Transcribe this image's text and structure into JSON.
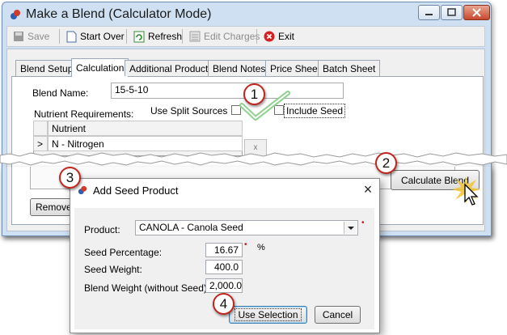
{
  "window": {
    "title": "Make a Blend (Calculator Mode)"
  },
  "toolbar": {
    "save": "Save",
    "start_over": "Start Over",
    "refresh": "Refresh",
    "edit_charges": "Edit Charges",
    "exit": "Exit"
  },
  "tabs": [
    {
      "label": "Blend Setup",
      "active": false
    },
    {
      "label": "Calculation",
      "active": true
    },
    {
      "label": "Additional Products",
      "active": false
    },
    {
      "label": "Blend Notes",
      "active": false
    },
    {
      "label": "Price Sheet",
      "active": false
    },
    {
      "label": "Batch Sheet",
      "active": false
    }
  ],
  "calc": {
    "blend_name_label": "Blend Name:",
    "blend_name_value": "15-5-10",
    "nutrient_req_label": "Nutrient Requirements:",
    "split_sources_label": "Use Split Sources",
    "include_seed_label": "Include Seed",
    "grid": {
      "header": "Nutrient",
      "rows": [
        {
          "marker": ">",
          "value": "N - Nitrogen"
        }
      ],
      "clear": "x"
    },
    "calculate_label": "Calculate Blend",
    "remove_label": "Remove"
  },
  "dialog": {
    "title": "Add Seed Product",
    "close_label": "×",
    "product_label": "Product:",
    "product_value": "CANOLA - Canola Seed",
    "seed_pct_label": "Seed Percentage:",
    "seed_pct_value": "16.67",
    "pct_unit": "%",
    "seed_weight_label": "Seed Weight:",
    "seed_weight_value": "400.0",
    "blend_weight_label": "Blend Weight (without Seed):",
    "blend_weight_value": "2,000.0",
    "use_selection": "Use Selection",
    "cancel": "Cancel"
  },
  "callouts": [
    "1",
    "2",
    "3",
    "4"
  ],
  "colors": {
    "window_border": "#6f8fb5",
    "callout_ring": "#c0261e",
    "checkmark": "#8fd18f",
    "required": "#d01010"
  }
}
